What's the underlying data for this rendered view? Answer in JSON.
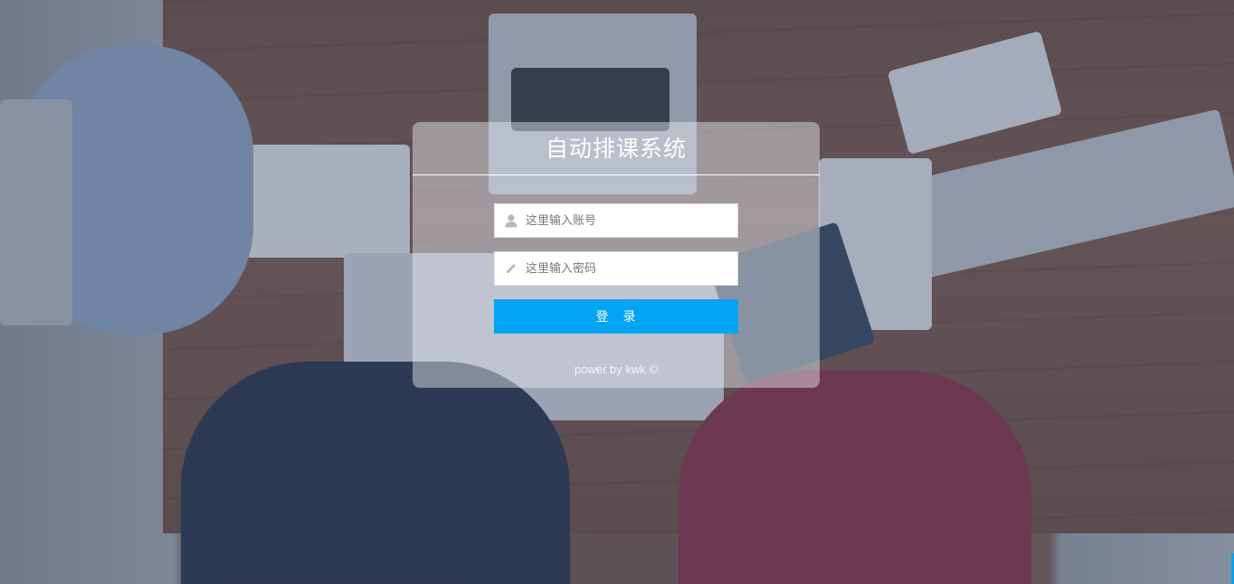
{
  "app": {
    "title": "自动排课系统"
  },
  "login_form": {
    "account_placeholder": "这里输入账号",
    "account_value": "",
    "password_placeholder": "这里输入密码",
    "password_value": "",
    "login_button_label": "登　录",
    "footer_text": "power by kwk ©"
  },
  "icons": {
    "account": "user-icon",
    "password": "pencil-icon"
  },
  "colors": {
    "accent": "#04a4f4",
    "card": "#ebeef5",
    "overlay": "#465578"
  }
}
